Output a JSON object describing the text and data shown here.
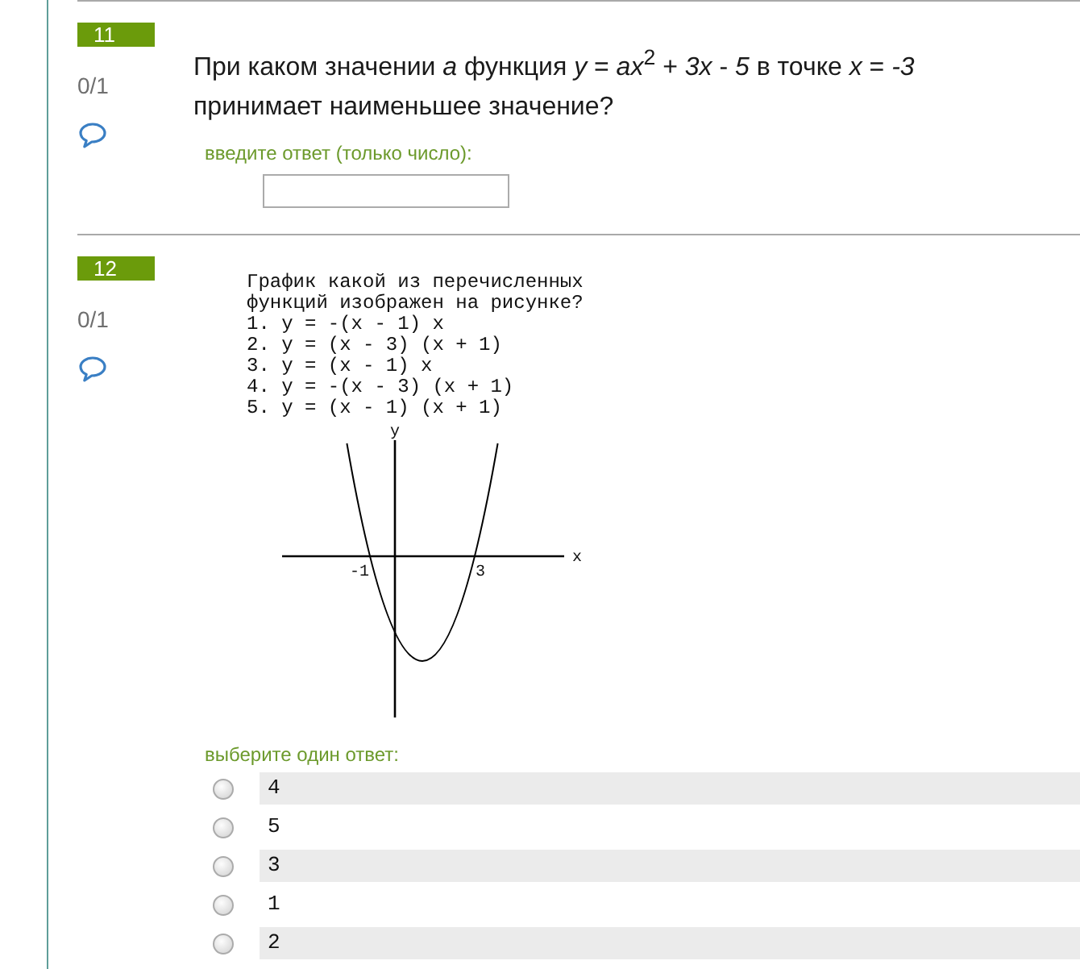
{
  "questions": [
    {
      "kind": "short_answer",
      "number": "11",
      "grade": "0/1",
      "text": "При каком значении *a* функция *y* = *ax*$^{2}$ + *3x* - *5* в точке *x* = *-3* принимает наименьшее значение?",
      "answer_prompt": "введите ответ (только число):"
    },
    {
      "kind": "multiple_choice",
      "number": "12",
      "grade": "0/1",
      "text": "График какой из перечисленных функций изображен на рисунке?",
      "functions": [
        "1. y = -(x - 1) x",
        "2. y = (x - 3) (x + 1)",
        "3. y = (x - 1) x",
        "4. y = -(x - 3) (x + 1)",
        "5. y = (x - 1) (x + 1)"
      ],
      "graph": {
        "x_axis_label": "x",
        "y_axis_label": "y",
        "x_tick_labels": [
          "-1",
          "3"
        ]
      },
      "answer_prompt": "выберите один ответ:",
      "options": [
        {
          "label": "4",
          "selected": false
        },
        {
          "label": "5",
          "selected": false
        },
        {
          "label": "3",
          "selected": false
        },
        {
          "label": "1",
          "selected": false
        },
        {
          "label": "2",
          "selected": false
        }
      ]
    }
  ]
}
